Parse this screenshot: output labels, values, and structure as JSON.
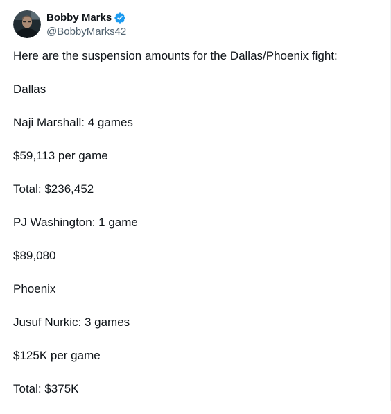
{
  "author": {
    "display_name": "Bobby Marks",
    "handle": "@BobbyMarks42",
    "verified": true,
    "verified_icon": "verified-badge-icon",
    "verified_color": "#1d9bf0"
  },
  "tweet": {
    "lines": [
      "Here are the suspension amounts for the Dallas/Phoenix fight:",
      "Dallas",
      "Naji Marshall: 4 games",
      "$59,113 per game",
      "Total: $236,452",
      "PJ Washington: 1 game",
      "$89,080",
      "Phoenix",
      "Jusuf Nurkic: 3 games",
      "$125K per game",
      "Total: $375K"
    ]
  },
  "colors": {
    "text": "#0f1419",
    "secondary_text": "#536471",
    "accent": "#1d9bf0"
  }
}
